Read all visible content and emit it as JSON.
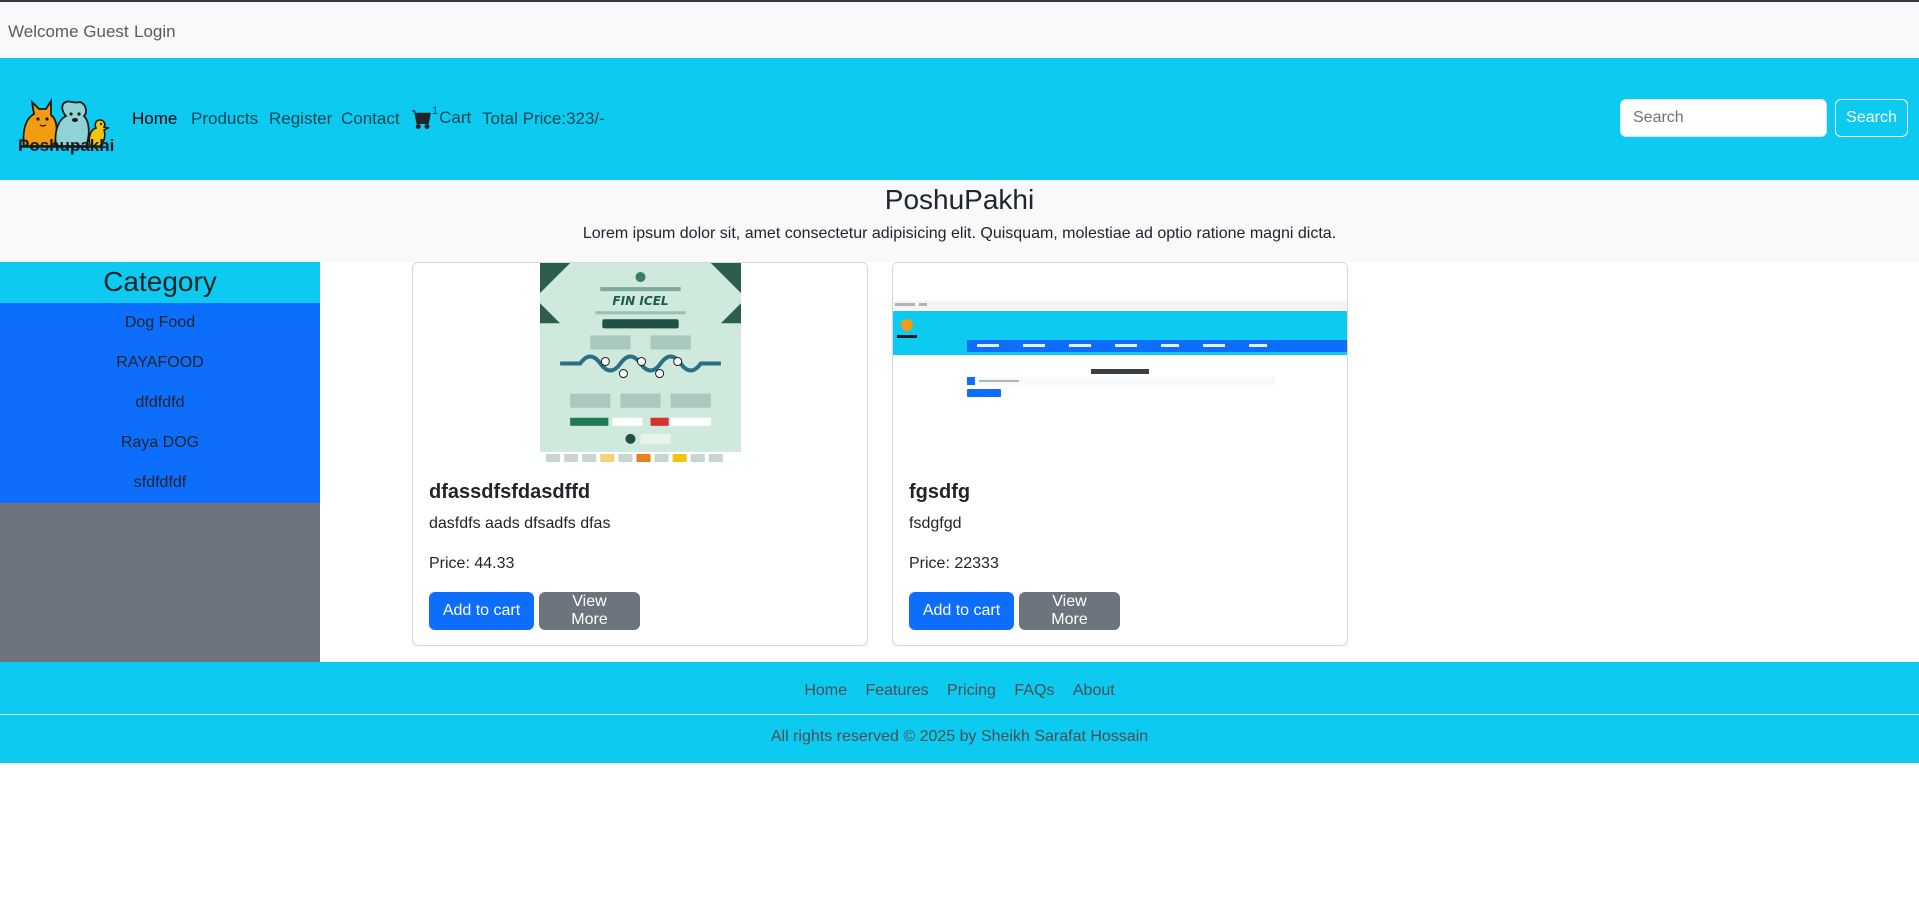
{
  "topbar": {
    "welcome": "Welcome Guest",
    "login": "Login"
  },
  "navbar": {
    "brand": "Poshupakhi",
    "links": [
      "Home",
      "Products",
      "Register",
      "Contact"
    ],
    "cart_count": "1",
    "cart_label": "Cart",
    "total_price": "Total Price:323/-",
    "search_placeholder": "Search",
    "search_button": "Search"
  },
  "hero": {
    "title": "PoshuPakhi",
    "subtitle": "Lorem ipsum dolor sit, amet consectetur adipisicing elit. Quisquam, molestiae ad optio ratione magni dicta."
  },
  "sidebar": {
    "heading": "Category",
    "items": [
      "Dog Food",
      "RAYAFOOD",
      "dfdfdfd",
      "Raya DOG",
      "sfdfdfdf"
    ]
  },
  "products": [
    {
      "title": "dfassdfsfdasdffd",
      "description": "dasfdfs aads dfsadfs dfas",
      "price": "Price: 44.33",
      "add_label": "Add to cart",
      "more_label": "View More"
    },
    {
      "title": "fgsdfg",
      "description": "fsdgfgd",
      "price": "Price: 22333",
      "add_label": "Add to cart",
      "more_label": "View More"
    }
  ],
  "footer": {
    "links": [
      "Home",
      "Features",
      "Pricing",
      "FAQs",
      "About"
    ],
    "copyright": "All rights reserved © 2025 by Sheikh Sarafat Hossain"
  },
  "colors": {
    "navbar": "#0dcaf0",
    "primary": "#0d6efd",
    "secondary": "#6c757d"
  }
}
